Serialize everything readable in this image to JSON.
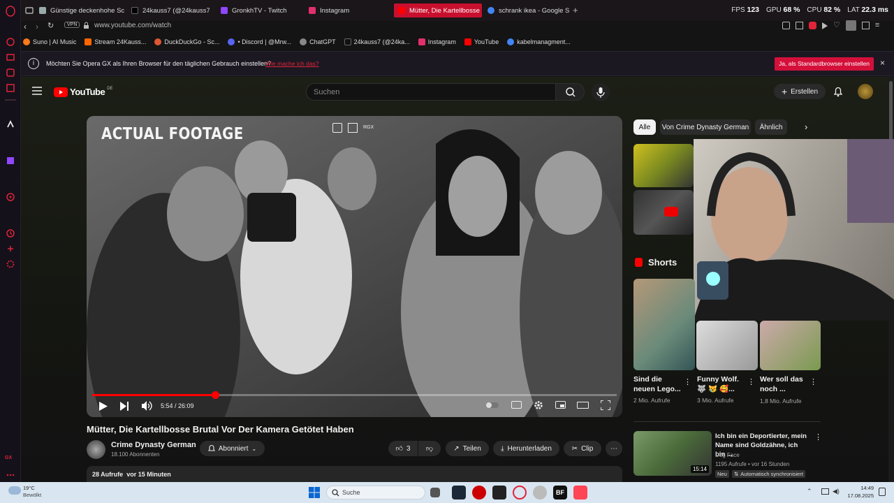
{
  "browser": {
    "tabs": [
      {
        "label": "Günstige deckenhohe Sch",
        "color": "#9aa"
      },
      {
        "label": "24kauss7 (@24kauss7) |",
        "color": "#fff"
      },
      {
        "label": "GronkhTV - Twitch",
        "color": "#9146ff"
      },
      {
        "label": "Instagram",
        "color": "#e1306c"
      },
      {
        "label": "Mütter, Die Kartellbosse B",
        "color": "#ff0000"
      },
      {
        "label": "schrank ikea - Google Su",
        "color": "#4285f4"
      }
    ],
    "stats": {
      "fps_label": "FPS",
      "fps": "123",
      "gpu_label": "GPU",
      "gpu": "68 %",
      "cpu_label": "CPU",
      "cpu": "82 %",
      "lat_label": "LAT",
      "lat": "22.3 ms"
    },
    "vpn": "VPN",
    "url": "www.youtube.com/watch",
    "bookmarks": [
      "Suno | AI Music",
      "Stream 24Kauss...",
      "DuckDuckGo - Sc...",
      "• Discord | @Mrw...",
      "ChatGPT",
      "24kauss7 (@24ka...",
      "Instagram",
      "YouTube",
      "kabelmanagment..."
    ],
    "notification": {
      "text": "Möchten Sie Opera GX als Ihren Browser für den täglichen Gebrauch einstellen?",
      "link": "Wie mache ich das?",
      "button": "Ja, als Standardbrowser einstellen"
    }
  },
  "youtube": {
    "logo": "YouTube",
    "region": "DE",
    "search_placeholder": "Suchen",
    "create_label": "Erstellen",
    "video": {
      "overlay_title": "ACTUAL FOOTAGE",
      "time": "5:54 / 26:09",
      "progress": 0.235,
      "title": "Mütter, Die Kartellbosse Brutal Vor Der Kamera Getötet Haben",
      "channel": "Crime Dynasty German",
      "subscribers": "18.100 Abonnenten",
      "subscribe_label": "Abonniert",
      "likes": "3",
      "share_label": "Teilen",
      "download_label": "Herunterladen",
      "clip_label": "Clip",
      "views": "28 Aufrufe",
      "age": "vor 15 Minuten"
    },
    "chips": [
      "Alle",
      "Von Crime Dynasty German",
      "Ähnlich"
    ],
    "shorts_title": "Shorts",
    "shorts": [
      {
        "title1": "Sind die",
        "title2": "neuen Lego...",
        "views": "2 Mio. Aufrufe"
      },
      {
        "title1": "Funny Wolf.",
        "title2": "🐺 😿 🥰...",
        "views": "3 Mio. Aufrufe"
      },
      {
        "title1": "Wer soll das",
        "title2": "noch ...",
        "views": "1,8 Mio. Aufrufe"
      }
    ],
    "recommended": {
      "title": "Ich bin ein Deportierter, mein Name sind Goldzähne, ich bin ...",
      "channel": "Dog Face",
      "meta": "1195 Aufrufe • vor 16 Stunden",
      "badge": "Neu",
      "sync": "Automatisch synchronisiert",
      "duration": "15:14"
    }
  },
  "taskbar": {
    "temp": "19°C",
    "weather": "Bewölkt",
    "search": "Suche",
    "time": "14:49",
    "date": "17.08.2025"
  }
}
